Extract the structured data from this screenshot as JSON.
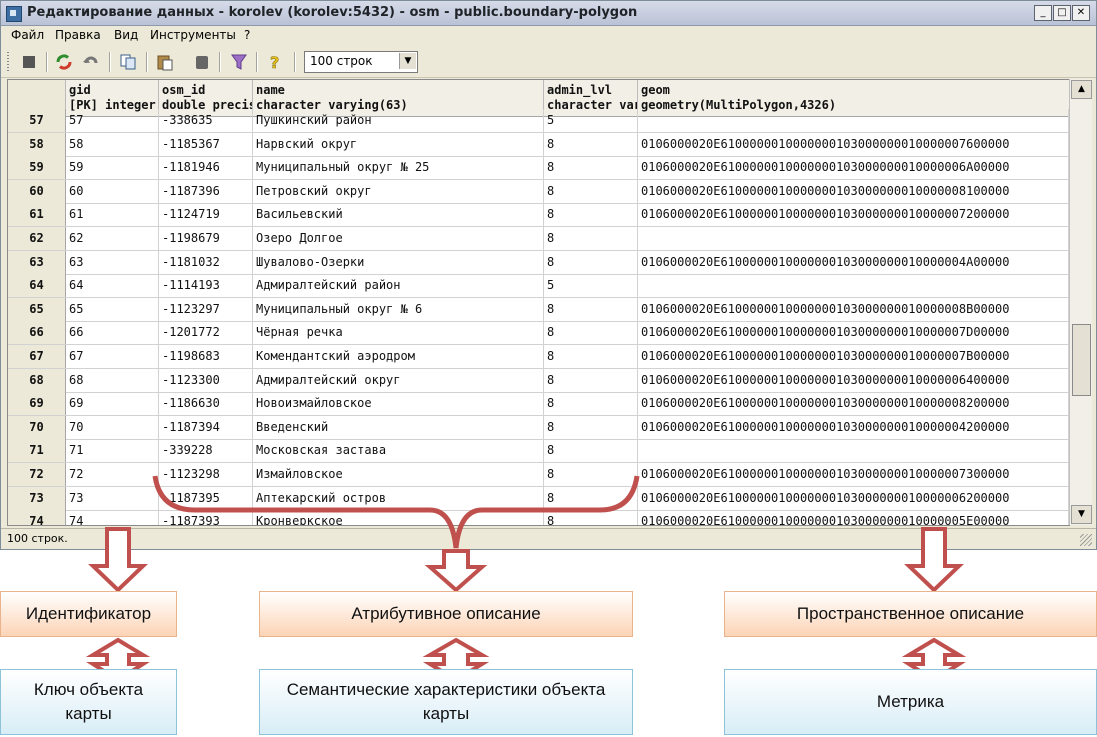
{
  "window": {
    "title": "Редактирование данных - korolev (korolev:5432) - osm - public.boundary-polygon",
    "buttons": [
      "_",
      "□",
      "✕"
    ]
  },
  "menu": {
    "items": [
      "Файл",
      "Правка",
      "Вид",
      "Инструменты",
      "?"
    ]
  },
  "toolbar": {
    "icons": [
      "stop-icon",
      "refresh-icon",
      "undo-icon",
      "copy-icon",
      "paste-icon",
      "delete-icon",
      "filter-icon",
      "help-icon"
    ],
    "rows_select": "100 строк"
  },
  "grid": {
    "columns": [
      {
        "name": "gid",
        "type": "[PK] integer"
      },
      {
        "name": "osm_id",
        "type": "double precis"
      },
      {
        "name": "name",
        "type": "character varying(63)"
      },
      {
        "name": "admin_lvl",
        "type": "character var"
      },
      {
        "name": "geom",
        "type": "geometry(MultiPolygon,4326)"
      }
    ],
    "rows": [
      {
        "rn": "57",
        "gid": "57",
        "osm_id": "-338635",
        "name": "Пушкинский район",
        "admin": "5",
        "geom": ""
      },
      {
        "rn": "58",
        "gid": "58",
        "osm_id": "-1185367",
        "name": "Нарвский округ",
        "admin": "8",
        "geom": "0106000020E6100000010000000103000000010000007600000"
      },
      {
        "rn": "59",
        "gid": "59",
        "osm_id": "-1181946",
        "name": "Муниципальный округ № 25",
        "admin": "8",
        "geom": "0106000020E6100000010000000103000000010000006A00000"
      },
      {
        "rn": "60",
        "gid": "60",
        "osm_id": "-1187396",
        "name": "Петровский округ",
        "admin": "8",
        "geom": "0106000020E6100000010000000103000000010000008100000"
      },
      {
        "rn": "61",
        "gid": "61",
        "osm_id": "-1124719",
        "name": "Васильевский",
        "admin": "8",
        "geom": "0106000020E6100000010000000103000000010000007200000"
      },
      {
        "rn": "62",
        "gid": "62",
        "osm_id": "-1198679",
        "name": "Озеро Долгое",
        "admin": "8",
        "geom": ""
      },
      {
        "rn": "63",
        "gid": "63",
        "osm_id": "-1181032",
        "name": "Шувалово-Озерки",
        "admin": "8",
        "geom": "0106000020E6100000010000000103000000010000004A00000"
      },
      {
        "rn": "64",
        "gid": "64",
        "osm_id": "-1114193",
        "name": "Адмиралтейский район",
        "admin": "5",
        "geom": ""
      },
      {
        "rn": "65",
        "gid": "65",
        "osm_id": "-1123297",
        "name": "Муниципальный округ № 6",
        "admin": "8",
        "geom": "0106000020E6100000010000000103000000010000008B00000"
      },
      {
        "rn": "66",
        "gid": "66",
        "osm_id": "-1201772",
        "name": "Чёрная речка",
        "admin": "8",
        "geom": "0106000020E6100000010000000103000000010000007D00000"
      },
      {
        "rn": "67",
        "gid": "67",
        "osm_id": "-1198683",
        "name": "Комендантский аэродром",
        "admin": "8",
        "geom": "0106000020E6100000010000000103000000010000007B00000"
      },
      {
        "rn": "68",
        "gid": "68",
        "osm_id": "-1123300",
        "name": "Адмиралтейский округ",
        "admin": "8",
        "geom": "0106000020E6100000010000000103000000010000006400000"
      },
      {
        "rn": "69",
        "gid": "69",
        "osm_id": "-1186630",
        "name": "Новоизмайловское",
        "admin": "8",
        "geom": "0106000020E6100000010000000103000000010000008200000"
      },
      {
        "rn": "70",
        "gid": "70",
        "osm_id": "-1187394",
        "name": "Введенский",
        "admin": "8",
        "geom": "0106000020E6100000010000000103000000010000004200000"
      },
      {
        "rn": "71",
        "gid": "71",
        "osm_id": "-339228",
        "name": "Московская застава",
        "admin": "8",
        "geom": ""
      },
      {
        "rn": "72",
        "gid": "72",
        "osm_id": "-1123298",
        "name": "Измайловское",
        "admin": "8",
        "geom": "0106000020E6100000010000000103000000010000007300000"
      },
      {
        "rn": "73",
        "gid": "73",
        "osm_id": "-1187395",
        "name": "Аптекарский остров",
        "admin": "8",
        "geom": "0106000020E6100000010000000103000000010000006200000"
      },
      {
        "rn": "74",
        "gid": "74",
        "osm_id": "-1187393",
        "name": "Кронверкское",
        "admin": "8",
        "geom": "0106000020E6100000010000000103000000010000005E00000"
      }
    ]
  },
  "status": "100 строк.",
  "diagram": {
    "top_boxes": [
      "Идентификатор",
      "Атрибутивное описание",
      "Пространственное описание"
    ],
    "bottom_boxes": [
      "Ключ объекта карты",
      "Семантические характеристики объекта карты",
      "Метрика"
    ],
    "arrow_color": "#c0504d",
    "top_box_color": "#fcd4b6",
    "bottom_box_color": "#d8edf6"
  }
}
